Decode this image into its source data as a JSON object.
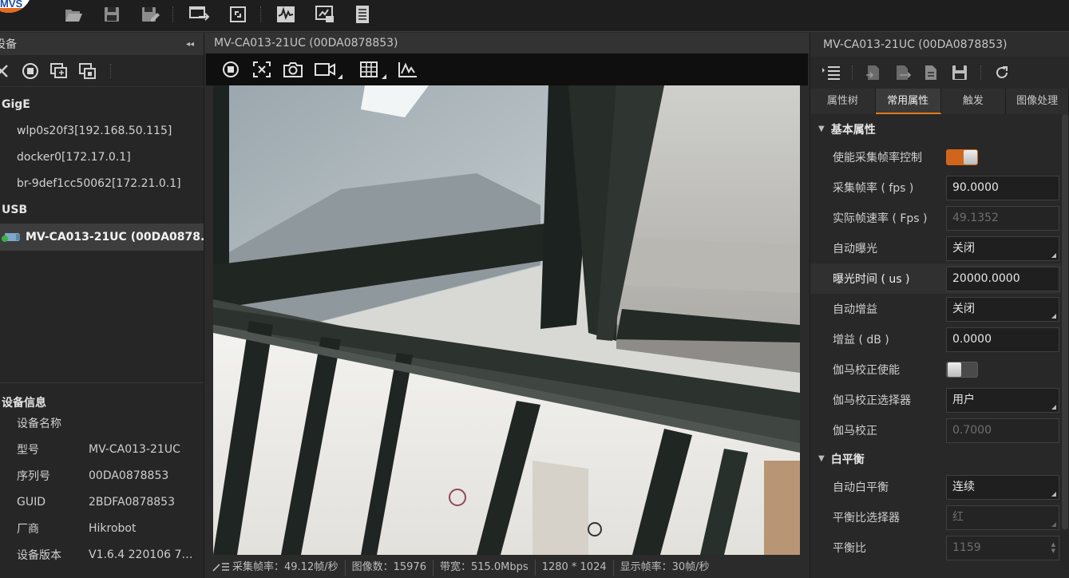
{
  "app": {
    "logo_text": "MVS"
  },
  "toolbar": {
    "icons": [
      "folder-open-icon",
      "save-icon",
      "save-as-icon",
      "multi-window-icon",
      "fullscreen-icon",
      "waveform-icon",
      "monitor-settings-icon",
      "list-icon"
    ]
  },
  "left_panel": {
    "title": "设备",
    "collapse_glyph": "◂◂",
    "tree": {
      "gige_label": "GigE",
      "gige_items": [
        "wlp0s20f3[192.168.50.115]",
        "docker0[172.17.0.1]",
        "br-9def1cc50062[172.21.0.1]"
      ],
      "usb_label": "USB",
      "usb_device": "MV-CA013-21UC (00DA0878..."
    },
    "info": {
      "title": "设备信息",
      "rows": [
        {
          "key": "设备名称",
          "value": ""
        },
        {
          "key": "型号",
          "value": "MV-CA013-21UC"
        },
        {
          "key": "序列号",
          "value": "00DA0878853"
        },
        {
          "key": "GUID",
          "value": "2BDFA0878853"
        },
        {
          "key": "厂商",
          "value": "Hikrobot"
        },
        {
          "key": "设备版本",
          "value": "V1.6.4 220106 747..."
        }
      ]
    }
  },
  "center": {
    "title": "MV-CA013-21UC (00DA0878853)",
    "status": {
      "fps": "采集帧率：49.12帧/秒",
      "images": "图像数：15976",
      "bandwidth": "带宽：515.0Mbps",
      "resolution": "1280 * 1024",
      "display_fps": "显示帧率：30帧/秒"
    }
  },
  "right_panel": {
    "title": "MV-CA013-21UC (00DA0878853)",
    "tabs": [
      "属性树",
      "常用属性",
      "触发",
      "图像处理"
    ],
    "active_tab": 1,
    "sections": {
      "basic": "基本属性",
      "wb": "白平衡"
    },
    "props": {
      "fr_enable": {
        "label": "使能采集帧率控制",
        "state": "on"
      },
      "fps": {
        "label": "采集帧率 ( fps )",
        "value": "90.0000"
      },
      "actual_fps": {
        "label": "实际帧速率 ( Fps )",
        "value": "49.1352"
      },
      "auto_exposure": {
        "label": "自动曝光",
        "value": "关闭"
      },
      "exposure": {
        "label": "曝光时间 ( us )",
        "value": "20000.0000"
      },
      "auto_gain": {
        "label": "自动增益",
        "value": "关闭"
      },
      "gain": {
        "label": "增益 ( dB )",
        "value": "0.0000"
      },
      "gamma_enable": {
        "label": "伽马校正使能",
        "state": "off"
      },
      "gamma_sel": {
        "label": "伽马校正选择器",
        "value": "用户"
      },
      "gamma": {
        "label": "伽马校正",
        "value": "0.7000"
      },
      "auto_wb": {
        "label": "自动白平衡",
        "value": "连续"
      },
      "balance_sel": {
        "label": "平衡比选择器",
        "value": "红"
      },
      "balance": {
        "label": "平衡比",
        "value": "1159"
      }
    },
    "accent_color": "#d0661c"
  }
}
